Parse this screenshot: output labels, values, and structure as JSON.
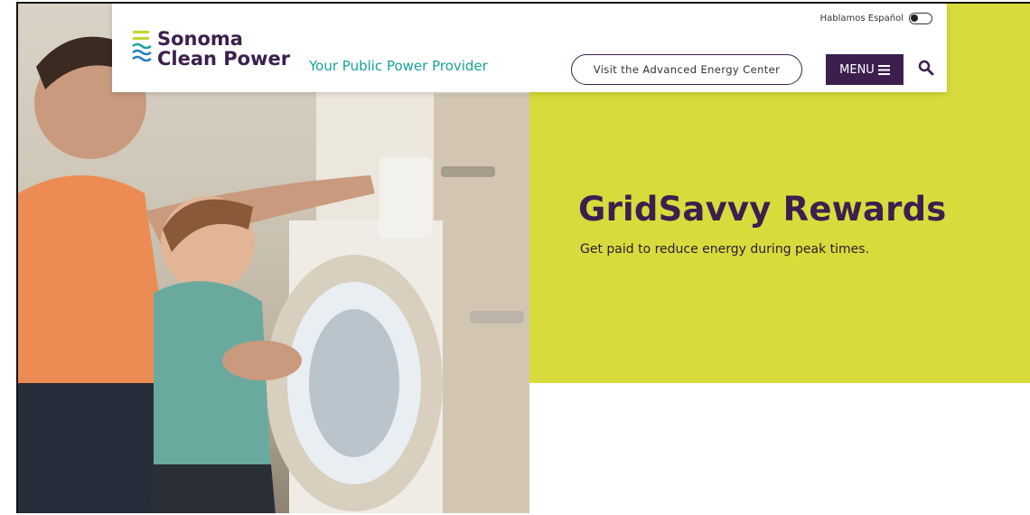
{
  "header": {
    "brand_line1": "Sonoma",
    "brand_line2": "Clean Power",
    "tagline": "Your Public Power Provider",
    "language_toggle_label": "Hablamos Español",
    "advanced_energy_center_label": "Visit the Advanced Energy Center",
    "menu_label": "MENU",
    "search_icon": "search-icon",
    "menu_icon": "hamburger-icon"
  },
  "hero": {
    "title": "GridSavvy Rewards",
    "subtitle": "Get paid to reduce energy during peak times."
  },
  "colors": {
    "brand_purple": "#3c1f4e",
    "accent_lime": "#d7dc3c",
    "tagline_teal": "#16a39a"
  }
}
